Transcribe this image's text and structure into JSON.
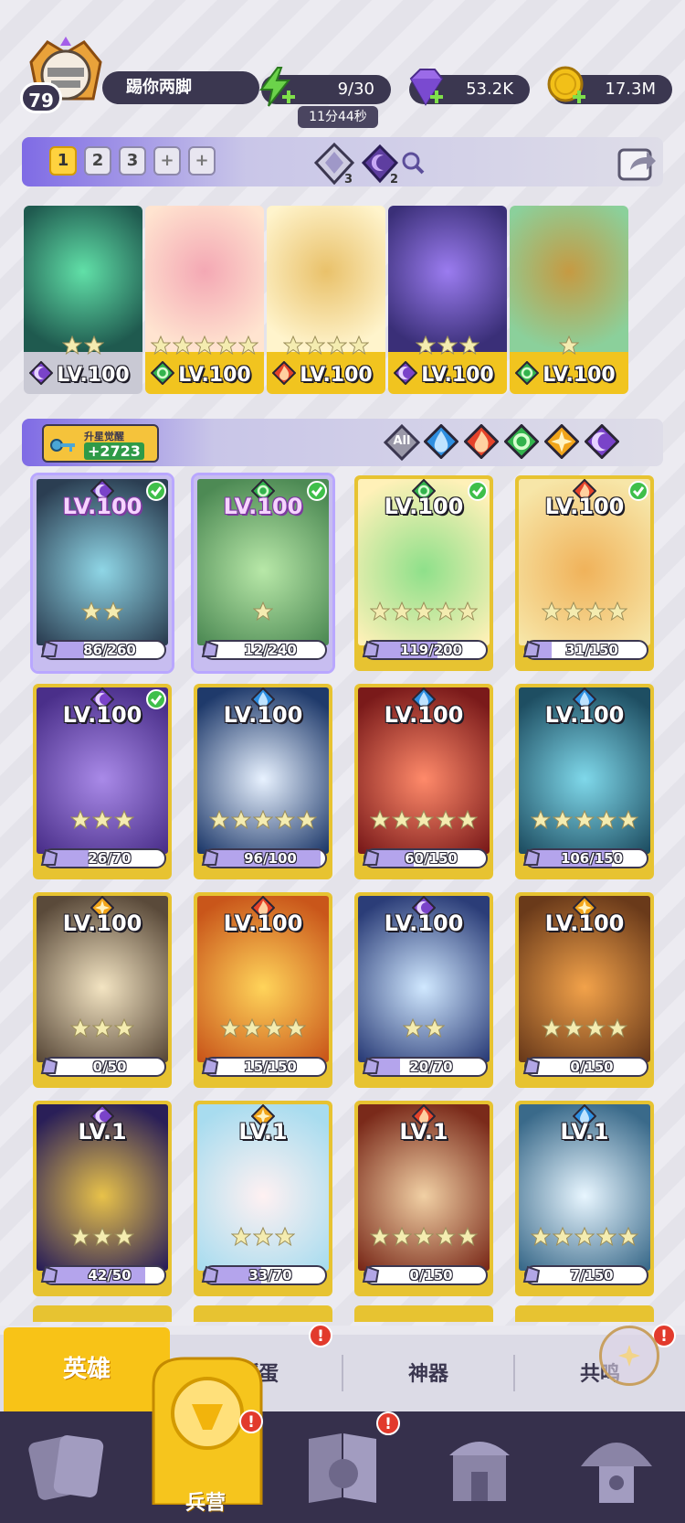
{
  "player": {
    "level": "79",
    "name": "踢你两脚"
  },
  "resources": {
    "energy": "9/30",
    "energy_timer": "11分44秒",
    "gems": "53.2K",
    "gold": "17.3M"
  },
  "team_panel": {
    "tabs": [
      "1",
      "2",
      "3",
      "+",
      "+"
    ],
    "active_tab": "1",
    "crystal_a_count": "3",
    "crystal_b_count": "2"
  },
  "team": [
    {
      "level": "LV.100",
      "element": "dark",
      "stars": 2,
      "strip": "gray"
    },
    {
      "level": "LV.100",
      "element": "nature",
      "stars": 5,
      "strip": "gold"
    },
    {
      "level": "LV.100",
      "element": "fire",
      "stars": 4,
      "strip": "gold"
    },
    {
      "level": "LV.100",
      "element": "dark",
      "stars": 3,
      "strip": "gold"
    },
    {
      "level": "LV.100",
      "element": "nature",
      "stars": 1,
      "strip": "gold"
    }
  ],
  "hero_panel": {
    "awaken_label": "升星觉醒",
    "awaken_value": "+2723",
    "filters": [
      "All",
      "water",
      "fire",
      "nature",
      "light",
      "dark"
    ],
    "filter_all_label": "All"
  },
  "heroes": [
    {
      "level": "LV.100",
      "element": "dark",
      "stars": 2,
      "progress": "86/260",
      "fill": 0.33,
      "check": true,
      "selected": true
    },
    {
      "level": "LV.100",
      "element": "nature",
      "stars": 1,
      "progress": "12/240",
      "fill": 0.05,
      "check": true,
      "selected": true
    },
    {
      "level": "LV.100",
      "element": "nature",
      "stars": 5,
      "progress": "119/200",
      "fill": 0.6,
      "check": true,
      "selected": false
    },
    {
      "level": "LV.100",
      "element": "fire",
      "stars": 4,
      "progress": "31/150",
      "fill": 0.21,
      "check": true,
      "selected": false
    },
    {
      "level": "LV.100",
      "element": "dark",
      "stars": 3,
      "progress": "26/70",
      "fill": 0.37,
      "check": true,
      "selected": false
    },
    {
      "level": "LV.100",
      "element": "water",
      "stars": 5,
      "progress": "96/100",
      "fill": 0.96,
      "check": false,
      "selected": false
    },
    {
      "level": "LV.100",
      "element": "water",
      "stars": 5,
      "progress": "60/150",
      "fill": 0.4,
      "check": false,
      "selected": false
    },
    {
      "level": "LV.100",
      "element": "water",
      "stars": 5,
      "progress": "106/150",
      "fill": 0.71,
      "check": false,
      "selected": false
    },
    {
      "level": "LV.100",
      "element": "light",
      "stars": 3,
      "progress": "0/50",
      "fill": 0,
      "check": false,
      "selected": false
    },
    {
      "level": "LV.100",
      "element": "fire",
      "stars": 4,
      "progress": "15/150",
      "fill": 0.1,
      "check": false,
      "selected": false
    },
    {
      "level": "LV.100",
      "element": "dark",
      "stars": 2,
      "progress": "20/70",
      "fill": 0.29,
      "check": false,
      "selected": false
    },
    {
      "level": "LV.100",
      "element": "light",
      "stars": 4,
      "progress": "0/150",
      "fill": 0,
      "check": false,
      "selected": false
    },
    {
      "level": "LV.1",
      "element": "dark",
      "stars": 3,
      "progress": "42/50",
      "fill": 0.84,
      "check": false,
      "selected": false
    },
    {
      "level": "LV.1",
      "element": "light",
      "stars": 3,
      "progress": "33/70",
      "fill": 0.47,
      "check": false,
      "selected": false
    },
    {
      "level": "LV.1",
      "element": "fire",
      "stars": 5,
      "progress": "0/150",
      "fill": 0,
      "check": false,
      "selected": false
    },
    {
      "level": "LV.1",
      "element": "water",
      "stars": 5,
      "progress": "7/150",
      "fill": 0.05,
      "check": false,
      "selected": false
    }
  ],
  "sub_tabs": [
    {
      "label": "英雄",
      "active": true,
      "badge": ""
    },
    {
      "label": "孵蛋",
      "active": false,
      "badge": "!"
    },
    {
      "label": "神器",
      "active": false,
      "badge": ""
    },
    {
      "label": "共鸣",
      "active": false,
      "badge": "!"
    }
  ],
  "nav": {
    "barracks_label": "兵营",
    "barracks_badge": "!",
    "book_badge": "!"
  },
  "colors": {
    "water": "#2f8fe0",
    "fire": "#e5432a",
    "nature": "#33b34d",
    "light": "#f2a51a",
    "dark": "#7a43c9",
    "gold": "#f5c317",
    "panel_dark": "#3b3750"
  }
}
